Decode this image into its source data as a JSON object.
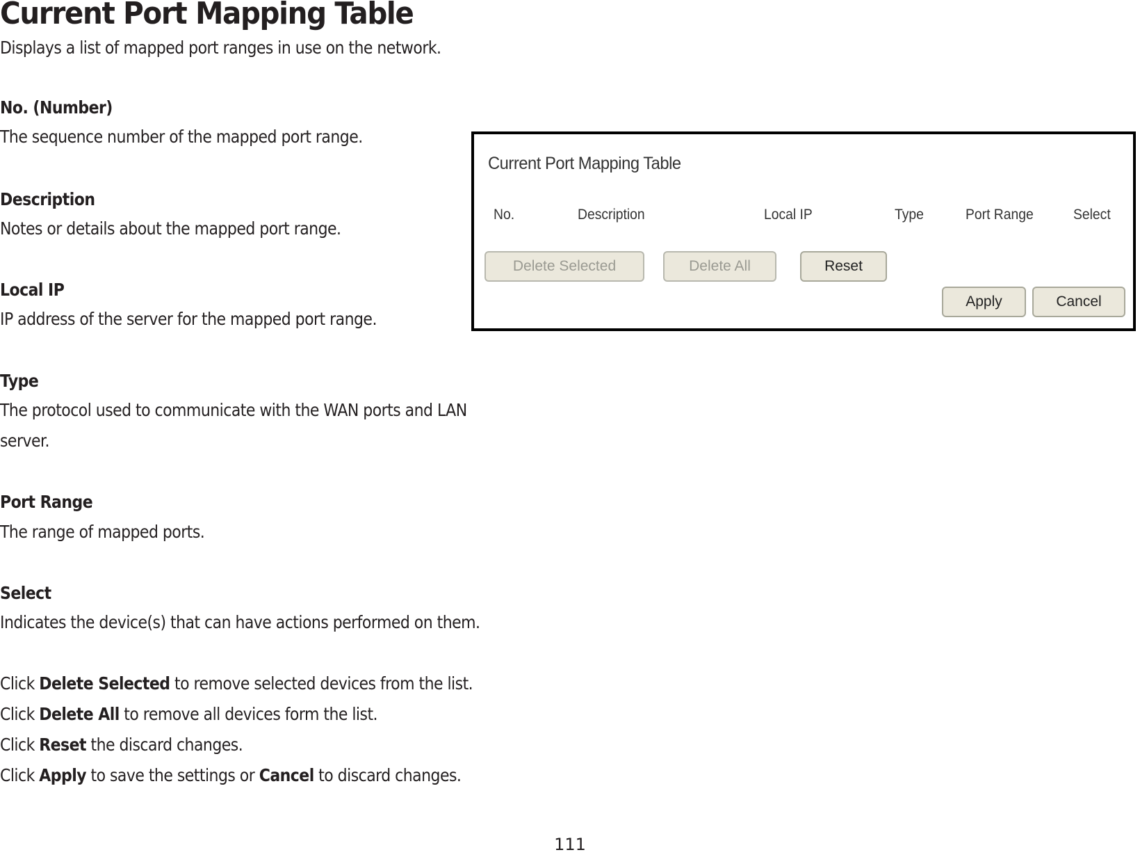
{
  "document": {
    "title": "Current Port Mapping Table",
    "intro": "Displays a list of mapped port ranges in use on the network.",
    "fields": [
      {
        "heading": "No. (Number)",
        "text": "The sequence number of the mapped port range."
      },
      {
        "heading": "Description",
        "text": "Notes or details about the mapped port range."
      },
      {
        "heading": "Local IP",
        "text": "IP address of the server for the mapped port range."
      },
      {
        "heading": "Type",
        "text": "The protocol used to communicate with the WAN ports and LAN",
        "text2": "server."
      },
      {
        "heading": "Port Range",
        "text": "The range of mapped ports."
      },
      {
        "heading": "Select",
        "text": "Indicates the device(s) that can have actions performed on them."
      }
    ],
    "actions": [
      {
        "pre": "Click ",
        "bold": "Delete Selected",
        "post": " to remove selected devices from the list."
      },
      {
        "pre": "Click ",
        "bold": "Delete All",
        "post": " to remove all devices form the list."
      },
      {
        "pre": "Click ",
        "bold": "Reset",
        "post": " the discard changes."
      },
      {
        "pre": "Click ",
        "bold": "Apply",
        "mid": " to save the settings or ",
        "bold2": "Cancel",
        "post": " to discard changes."
      }
    ],
    "page_number": "111"
  },
  "screenshot": {
    "title": "Current Port Mapping Table",
    "columns": [
      "No.",
      "Description",
      "Local IP",
      "Type",
      "Port Range",
      "Select"
    ],
    "buttons": {
      "delete_selected": {
        "label": "Delete Selected",
        "state": "disabled"
      },
      "delete_all": {
        "label": "Delete All",
        "state": "disabled"
      },
      "reset": {
        "label": "Reset",
        "state": "enabled"
      },
      "apply": {
        "label": "Apply",
        "state": "enabled"
      },
      "cancel": {
        "label": "Cancel",
        "state": "enabled"
      }
    }
  }
}
